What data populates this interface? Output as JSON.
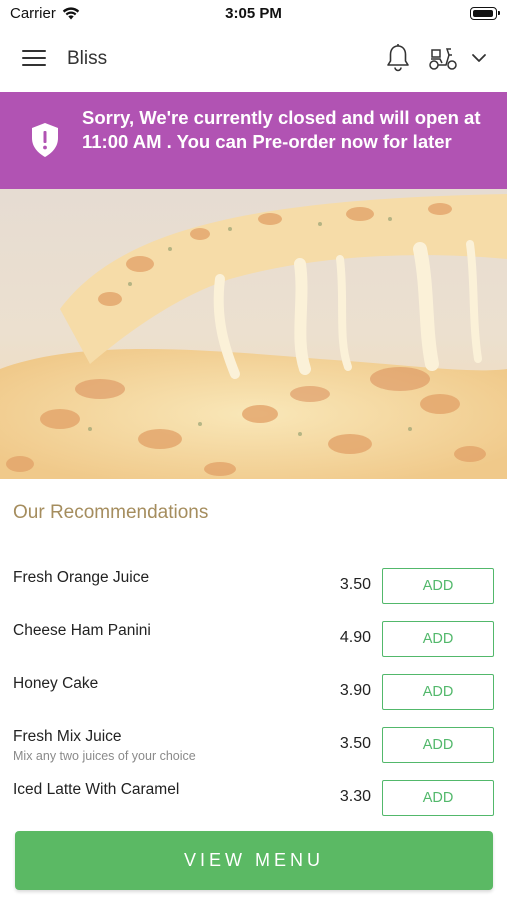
{
  "status_bar": {
    "carrier": "Carrier",
    "time": "3:05 PM"
  },
  "header": {
    "title": "Bliss",
    "icons": [
      "menu-icon",
      "bell-icon",
      "scooter-icon",
      "chevron-down-icon"
    ]
  },
  "banner": {
    "text": "Sorry, We're currently closed and will open at 11:00 AM . You can Pre-order now for later",
    "color": "#b153b3",
    "icon": "shield-alert-icon"
  },
  "hero": {
    "image": "cheese pizza slice being lifted"
  },
  "recommendations": {
    "title": "Our Recommendations",
    "items": [
      {
        "name": "Fresh Orange Juice",
        "description": "",
        "price": "3.50",
        "button": "ADD"
      },
      {
        "name": "Cheese Ham Panini",
        "description": "",
        "price": "4.90",
        "button": "ADD"
      },
      {
        "name": "Honey Cake",
        "description": "",
        "price": "3.90",
        "button": "ADD"
      },
      {
        "name": "Fresh Mix Juice",
        "description": "Mix any two juices of your choice",
        "price": "3.50",
        "button": "ADD"
      },
      {
        "name": "Iced Latte With Caramel",
        "description": "",
        "price": "3.30",
        "button": "ADD"
      }
    ]
  },
  "footer": {
    "view_menu_label": "VIEW MENU",
    "color": "#5bb964"
  },
  "colors": {
    "accent_green": "#52b86b",
    "section_title": "#a58d5e"
  }
}
